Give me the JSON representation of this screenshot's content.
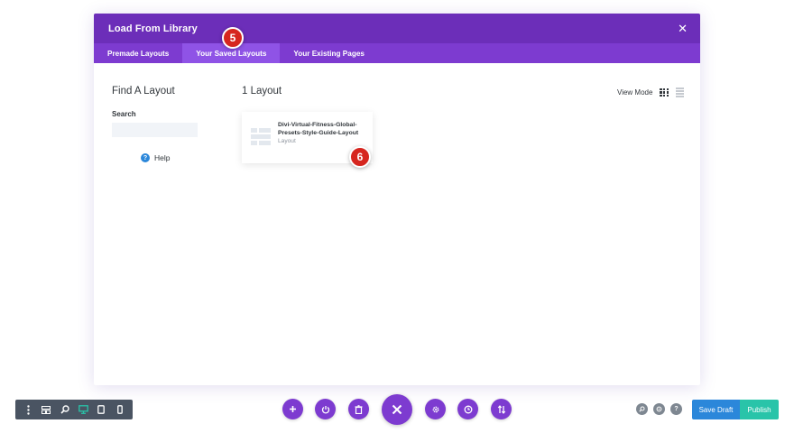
{
  "modal": {
    "title": "Load From Library",
    "tabs": [
      {
        "label": "Premade Layouts"
      },
      {
        "label": "Your Saved Layouts"
      },
      {
        "label": "Your Existing Pages"
      }
    ],
    "active_tab": "Your Saved Layouts"
  },
  "sidebar": {
    "title": "Find A Layout",
    "search_label": "Search",
    "search_value": "",
    "help_label": "Help"
  },
  "main": {
    "count_title": "1 Layout",
    "view_mode_label": "View Mode",
    "layouts": [
      {
        "name": "Divi-Virtual-Fitness-Global-Presets-Style-Guide-Layout",
        "type": "Layout"
      }
    ]
  },
  "badges": {
    "tab_step": "5",
    "card_step": "6"
  },
  "footer": {
    "save_draft_label": "Save Draft",
    "publish_label": "Publish"
  },
  "colors": {
    "header_purple": "#6c2eb9",
    "tab_purple": "#7d3bd0",
    "active_tab": "#8f53e6",
    "badge_red": "#d6261f",
    "save_draft_blue": "#2b87da",
    "publish_green": "#29c4a9",
    "toolbar_gray": "#4a5462"
  }
}
